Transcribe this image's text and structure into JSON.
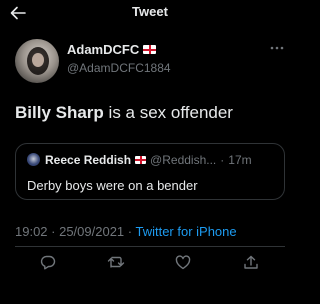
{
  "topbar": {
    "title": "Tweet"
  },
  "author": {
    "display_name": "AdamDCFC",
    "handle": "@AdamDCFC1884"
  },
  "tweet": {
    "text_bold": "Billy Sharp",
    "text_rest": " is a sex offender"
  },
  "quoted_tweet": {
    "display_name": "Reece Reddish",
    "handle": "@Reddish...",
    "separator": "·",
    "time": "17m",
    "text": "Derby boys were on a bender"
  },
  "meta": {
    "timestamp": "19:02 · 25/09/2021 · ",
    "source": "Twitter for iPhone"
  },
  "icons": {
    "back": "arrow-left-icon",
    "more": "more-horizontal-icon",
    "reply": "reply-icon",
    "retweet": "retweet-icon",
    "like": "heart-icon",
    "share": "share-icon"
  },
  "colors": {
    "background": "#000000",
    "text": "#e7e9ea",
    "secondary": "#71767b",
    "accent": "#1d9bf0",
    "border": "#2f3336"
  }
}
